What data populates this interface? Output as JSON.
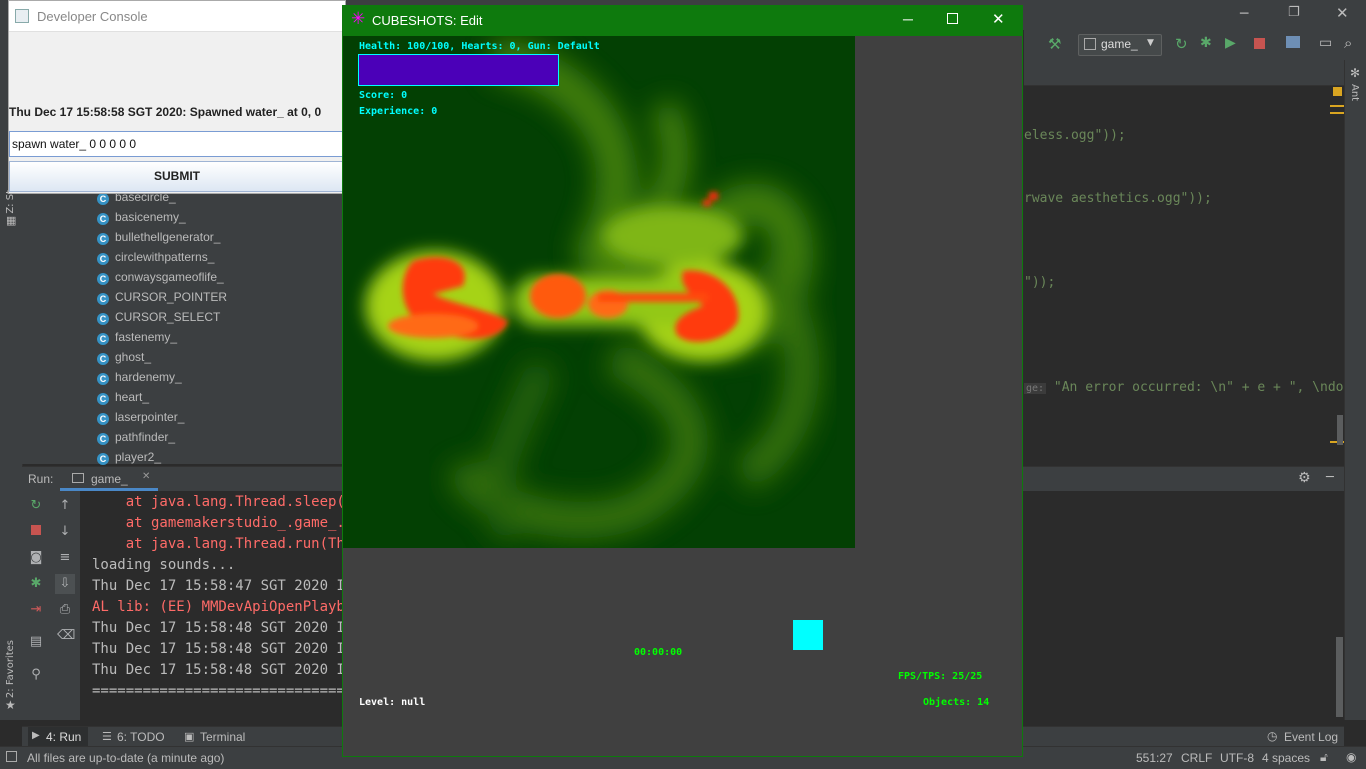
{
  "ide": {
    "run_config": "game_",
    "ant_label": "Ant",
    "editor_lines": [
      {
        "text": "eless.ogg\"));",
        "hint": ""
      },
      {
        "text": "rwave aesthetics.ogg\"));",
        "hint": ""
      },
      {
        "text": "\"));",
        "hint": ""
      },
      {
        "text": "\"An error occurred: \\n\" + e + \", \\ndo",
        "hint": "ge:"
      }
    ],
    "project_tree": [
      "basecircle_",
      "basicenemy_",
      "bullethellgenerator_",
      "circlewithpatterns_",
      "conwaysgameoflife_",
      "CURSOR_POINTER",
      "CURSOR_SELECT",
      "fastenemy_",
      "ghost_",
      "hardenemy_",
      "heart_",
      "laserpointer_",
      "pathfinder_",
      "player2_"
    ],
    "left_strip_labels": {
      "structure": "Z: St",
      "favorites": "2: Favorites"
    },
    "run_label": "Run:",
    "run_tab": "game_",
    "console_lines": [
      {
        "text": "    at java.lang.Thread.sleep(Na",
        "type": "err"
      },
      {
        "text": "    at gamemakerstudio_.game_.ru",
        "type": "err"
      },
      {
        "text": "    at java.lang.Thread.run(Thre",
        "type": "err"
      },
      {
        "text": "loading sounds...",
        "type": "normal"
      },
      {
        "text": "Thu Dec 17 15:58:47 SGT 2020 INF",
        "type": "normal"
      },
      {
        "text": "AL lib: (EE) MMDevApiOpenPlayback",
        "type": "err"
      },
      {
        "text": "Thu Dec 17 15:58:48 SGT 2020 INF",
        "type": "normal"
      },
      {
        "text": "Thu Dec 17 15:58:48 SGT 2020 INF",
        "type": "normal"
      },
      {
        "text": "Thu Dec 17 15:58:48 SGT 2020 INF",
        "type": "normal"
      },
      {
        "text": "=================================",
        "type": "normal"
      }
    ],
    "bottom_tabs": {
      "run": "4: Run",
      "todo": "6: TODO",
      "terminal": "Terminal",
      "event_log": "Event Log"
    },
    "status": {
      "message": "All files are up-to-date (a minute ago)",
      "position": "551:27",
      "line_sep": "CRLF",
      "encoding": "UTF-8",
      "indent": "4 spaces"
    }
  },
  "dev_console": {
    "title": "Developer Console",
    "message": "Thu Dec 17 15:58:58 SGT 2020: Spawned water_ at 0, 0",
    "input_value": "spawn water_ 0 0 0 0 0",
    "submit_label": "SUBMIT"
  },
  "game": {
    "title": "CUBESHOTS: Edit",
    "hud": {
      "status": "Health: 100/100, Hearts: 0, Gun: Default",
      "score": "Score: 0",
      "experience": "Experience: 0",
      "timer": "00:00:00",
      "fps": "FPS/TPS: 25/25",
      "level": "Level: null",
      "objects": "Objects: 14"
    },
    "colors": {
      "health_bar": "#4b00b8",
      "player": "#00ffff",
      "titlebar": "#0e7a0d"
    }
  }
}
